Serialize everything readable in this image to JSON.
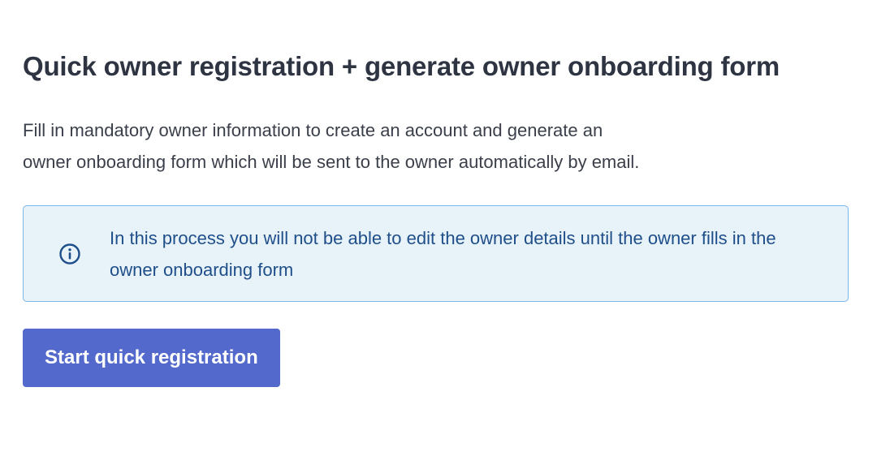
{
  "page": {
    "title": "Quick owner registration + generate owner onboarding form",
    "description": "Fill in mandatory owner information to create an account and generate an owner onboarding form which will be sent to the owner automatically by email."
  },
  "info_box": {
    "icon": "info-circle-icon",
    "text": "In this process you will not be able to edit the owner details until the owner fills in the owner onboarding form"
  },
  "actions": {
    "start_label": "Start quick registration"
  },
  "colors": {
    "button_bg": "#5469cc",
    "info_bg": "#e8f2f9",
    "info_border": "#7ab8ec",
    "info_text": "#1f4f8a",
    "title_text": "#2e3442"
  }
}
